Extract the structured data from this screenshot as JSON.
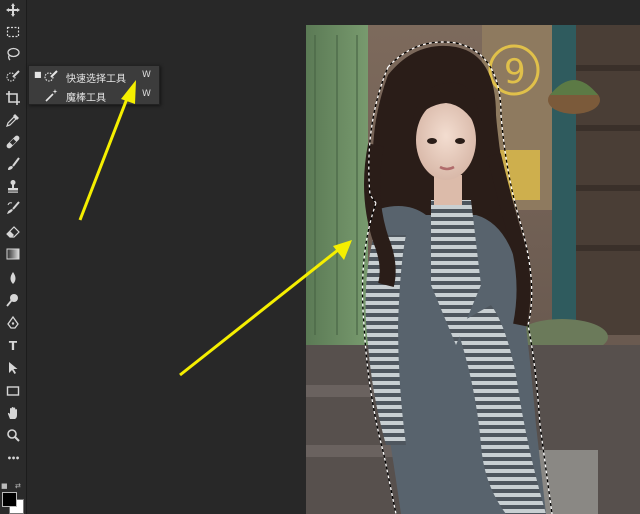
{
  "toolbar": {
    "tools": [
      {
        "name": "move-tool",
        "icon": "move-icon"
      },
      {
        "name": "marquee-tool",
        "icon": "rect-marquee-icon"
      },
      {
        "name": "lasso-tool",
        "icon": "lasso-icon"
      },
      {
        "name": "quick-selection-tool",
        "icon": "quick-selection-icon"
      },
      {
        "name": "crop-tool",
        "icon": "crop-icon"
      },
      {
        "name": "eyedropper-tool",
        "icon": "eyedropper-icon"
      },
      {
        "name": "healing-brush-tool",
        "icon": "bandage-icon"
      },
      {
        "name": "brush-tool",
        "icon": "brush-icon"
      },
      {
        "name": "clone-stamp-tool",
        "icon": "stamp-icon"
      },
      {
        "name": "history-brush-tool",
        "icon": "history-brush-icon"
      },
      {
        "name": "eraser-tool",
        "icon": "eraser-icon"
      },
      {
        "name": "gradient-tool",
        "icon": "gradient-icon"
      },
      {
        "name": "blur-tool",
        "icon": "drop-icon"
      },
      {
        "name": "dodge-tool",
        "icon": "dodge-icon"
      },
      {
        "name": "pen-tool",
        "icon": "pen-icon"
      },
      {
        "name": "type-tool",
        "icon": "type-icon",
        "label": "T"
      },
      {
        "name": "path-selection-tool",
        "icon": "arrow-cursor-icon"
      },
      {
        "name": "shape-tool",
        "icon": "rectangle-icon"
      },
      {
        "name": "hand-tool",
        "icon": "hand-icon"
      },
      {
        "name": "zoom-tool",
        "icon": "zoom-icon"
      },
      {
        "name": "more-tools",
        "icon": "ellipsis-icon",
        "label": "•••"
      }
    ],
    "foreground_color": "#000000",
    "background_color": "#ffffff"
  },
  "flyout": {
    "items": [
      {
        "label": "快速选择工具",
        "shortcut": "W",
        "selected": true,
        "icon": "quick-selection-icon"
      },
      {
        "label": "魔棒工具",
        "shortcut": "W",
        "selected": false,
        "icon": "magic-wand-icon"
      }
    ]
  },
  "annotation_color": "#f5ef00"
}
